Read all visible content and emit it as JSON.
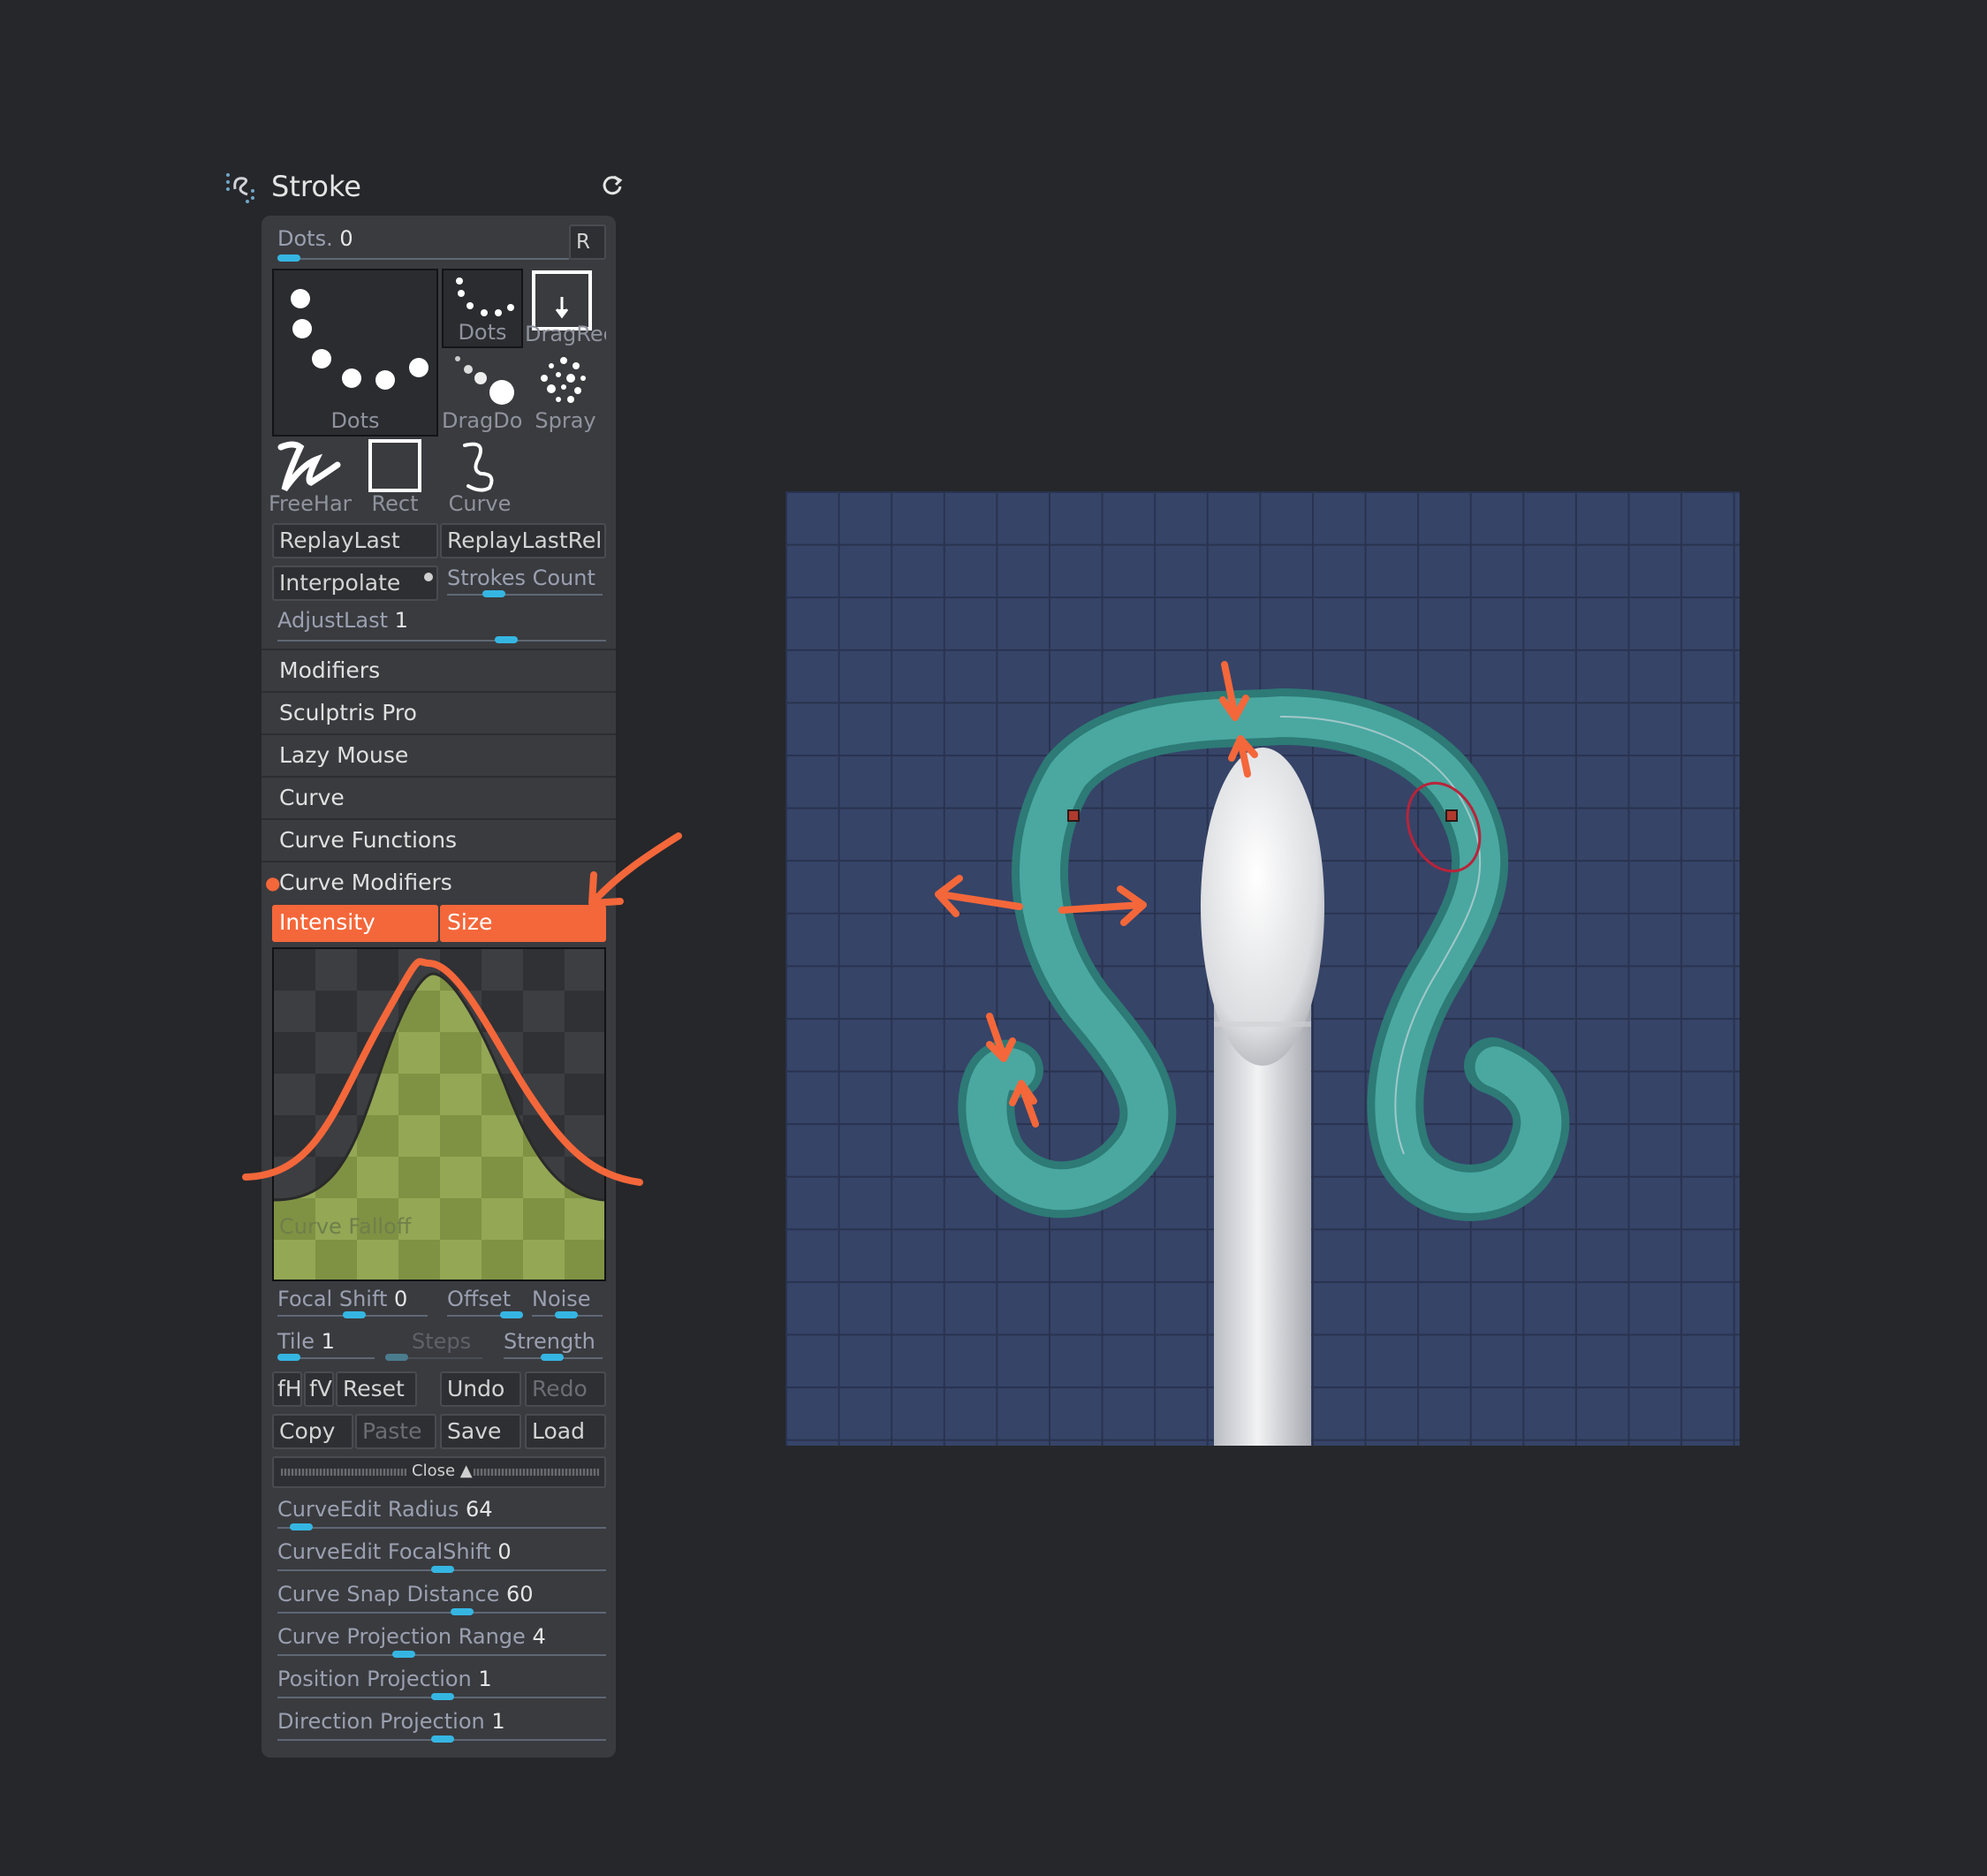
{
  "palette": {
    "title": "Stroke",
    "dots_label": "Dots.",
    "dots_value": "0",
    "r_label": "R",
    "stroke_types": {
      "big_dots": "Dots",
      "dots": "Dots",
      "dragrect": "DragRect",
      "dragdot": "DragDot",
      "spray": "Spray",
      "freehand": "FreeHand",
      "rect": "Rect",
      "curve": "Curve"
    },
    "replay_last": "ReplayLast",
    "replay_last_rel": "ReplayLastRel",
    "interpolate": "Interpolate",
    "strokes_count": "Strokes Count",
    "adjust_last_label": "AdjustLast",
    "adjust_last_value": "1",
    "sections": [
      "Modifiers",
      "Sculptris Pro",
      "Lazy Mouse",
      "Curve",
      "Curve Functions",
      "Curve Modifiers"
    ],
    "curve_modifiers": {
      "intensity": "Intensity",
      "size": "Size",
      "curve_falloff": "Curve Falloff"
    },
    "falloff": {
      "focal_shift_label": "Focal Shift",
      "focal_shift_value": "0",
      "offset": "Offset",
      "noise": "Noise",
      "tile_label": "Tile",
      "tile_value": "1",
      "steps": "Steps",
      "strength": "Strength",
      "fh": "fH",
      "fv": "fV",
      "reset": "Reset",
      "undo": "Undo",
      "redo": "Redo",
      "copy": "Copy",
      "paste": "Paste",
      "save": "Save",
      "load": "Load",
      "close": "Close"
    },
    "curve_sliders": [
      {
        "label": "CurveEdit Radius",
        "value": "64"
      },
      {
        "label": "CurveEdit FocalShift",
        "value": "0"
      },
      {
        "label": "Curve Snap Distance",
        "value": "60"
      },
      {
        "label": "Curve Projection Range",
        "value": "4"
      },
      {
        "label": "Position Projection",
        "value": "1"
      },
      {
        "label": "Direction Projection",
        "value": "1"
      }
    ]
  },
  "colors": {
    "accent": "#f4673a",
    "slider": "#35b6e2",
    "panel": "#3a3b3f",
    "viewport": "#364468",
    "tentacle": "#3f9a94",
    "falloff_fill": "#8da150"
  },
  "icons": [
    "stroke-icon",
    "refresh-icon",
    "annotation-arrow-icon"
  ]
}
